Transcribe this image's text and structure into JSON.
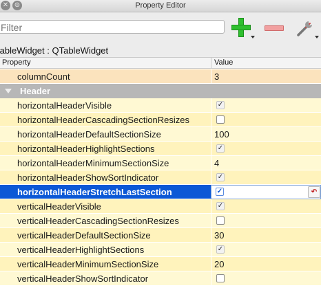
{
  "window": {
    "title": "Property Editor",
    "close_glyph": "✕",
    "float_glyph": "⊜"
  },
  "toolbar": {
    "filter_placeholder": "Filter",
    "add_icon": "plus-icon",
    "remove_icon": "minus-icon",
    "config_icon": "wrench-icon"
  },
  "object_path": "tableWidget : QTableWidget",
  "table": {
    "columns": [
      "Property",
      "Value"
    ],
    "rows": [
      {
        "name": "columnCount",
        "value": "3",
        "type": "text",
        "shade": "#fbe3bd"
      },
      {
        "name": "Header",
        "type": "group"
      },
      {
        "name": "horizontalHeaderVisible",
        "type": "checkbox",
        "checked": true,
        "disabled": true,
        "shade": "#fff9d3"
      },
      {
        "name": "horizontalHeaderCascadingSectionResizes",
        "type": "checkbox",
        "checked": false,
        "disabled": false,
        "shade": "#fff3bc"
      },
      {
        "name": "horizontalHeaderDefaultSectionSize",
        "value": "100",
        "type": "text",
        "shade": "#fff9d3"
      },
      {
        "name": "horizontalHeaderHighlightSections",
        "type": "checkbox",
        "checked": true,
        "disabled": true,
        "shade": "#fff3bc"
      },
      {
        "name": "horizontalHeaderMinimumSectionSize",
        "value": "4",
        "type": "text",
        "shade": "#fff9d3"
      },
      {
        "name": "horizontalHeaderShowSortIndicator",
        "type": "checkbox",
        "checked": true,
        "disabled": true,
        "shade": "#fff3bc"
      },
      {
        "name": "horizontalHeaderStretchLastSection",
        "type": "checkbox",
        "checked": true,
        "disabled": false,
        "selected": true,
        "reset_glyph": "↶"
      },
      {
        "name": "verticalHeaderVisible",
        "type": "checkbox",
        "checked": true,
        "disabled": true,
        "shade": "#fff3bc"
      },
      {
        "name": "verticalHeaderCascadingSectionResizes",
        "type": "checkbox",
        "checked": false,
        "disabled": false,
        "shade": "#fff9d3"
      },
      {
        "name": "verticalHeaderDefaultSectionSize",
        "value": "30",
        "type": "text",
        "shade": "#fff3bc"
      },
      {
        "name": "verticalHeaderHighlightSections",
        "type": "checkbox",
        "checked": true,
        "disabled": true,
        "shade": "#fff9d3"
      },
      {
        "name": "verticalHeaderMinimumSectionSize",
        "value": "20",
        "type": "text",
        "shade": "#fff3bc"
      },
      {
        "name": "verticalHeaderShowSortIndicator",
        "type": "checkbox",
        "checked": false,
        "disabled": false,
        "shade": "#fff9d3"
      }
    ]
  },
  "colors": {
    "selection": "#0b58d6",
    "group": "#b7b7b7",
    "add": "#2fbf2f",
    "remove": "#f2a0a0"
  }
}
